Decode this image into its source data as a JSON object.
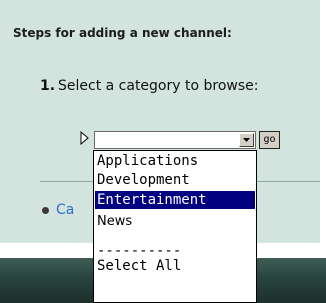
{
  "heading": "Steps for adding a new channel:",
  "step": {
    "number": "1.",
    "text": "Select a category to browse:"
  },
  "combo": {
    "value": "",
    "go_label": "go"
  },
  "link": {
    "text": "Ca"
  },
  "dropdown": {
    "items": [
      {
        "label": "Applications",
        "selected": false
      },
      {
        "label": "Development",
        "selected": false
      },
      {
        "label": "Entertainment",
        "selected": true
      },
      {
        "label": "News",
        "selected": false
      },
      {
        "label": "----------",
        "selected": false
      },
      {
        "label": "Select All",
        "selected": false
      }
    ]
  },
  "colors": {
    "panel": "#d2e4dd",
    "selection": "#000080",
    "link": "#2f6fd0"
  }
}
